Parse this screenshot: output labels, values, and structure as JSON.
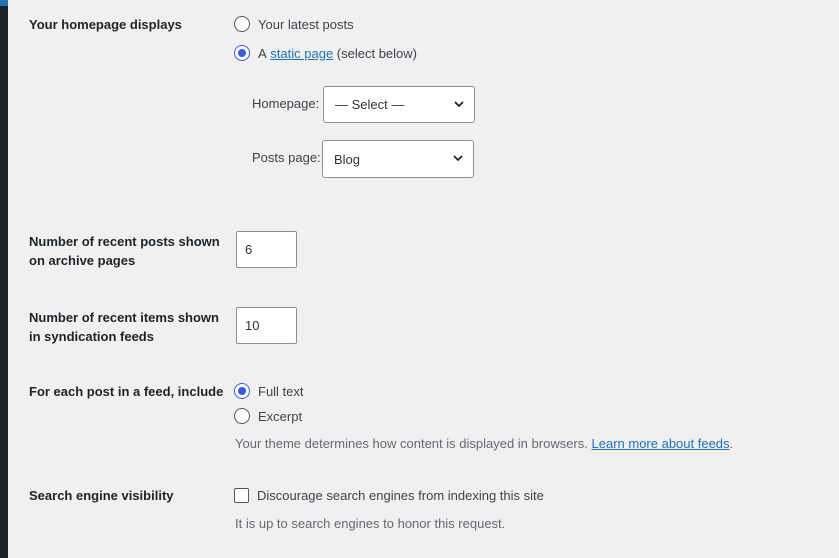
{
  "homepage_displays": {
    "label": "Your homepage displays",
    "option_latest": "Your latest posts",
    "option_static_prefix": "A",
    "option_static_link": "static page",
    "option_static_suffix": "(select below)",
    "selected": "static",
    "homepage_label": "Homepage:",
    "homepage_value": "— Select —",
    "posts_page_label": "Posts page:",
    "posts_page_value": "Blog"
  },
  "archive_posts": {
    "label": "Number of recent posts shown on archive pages",
    "value": "6"
  },
  "feed_items": {
    "label": "Number of recent items shown in syndication feeds",
    "value": "10"
  },
  "feed_content": {
    "label": "For each post in a feed, include",
    "option_full": "Full text",
    "option_excerpt": "Excerpt",
    "selected": "full",
    "description": "Your theme determines how content is displayed in browsers.",
    "link": "Learn more about feeds",
    "link_suffix": "."
  },
  "search_visibility": {
    "label": "Search engine visibility",
    "checkbox_label": "Discourage search engines from indexing this site",
    "checked": false,
    "description": "It is up to search engines to honor this request."
  },
  "colors": {
    "background": "#f0f0f1",
    "accent": "#3858e9",
    "link": "#2271b1",
    "sidebar": "#1d2327"
  },
  "icons": {
    "select_chevron": "chevron-down-icon"
  }
}
